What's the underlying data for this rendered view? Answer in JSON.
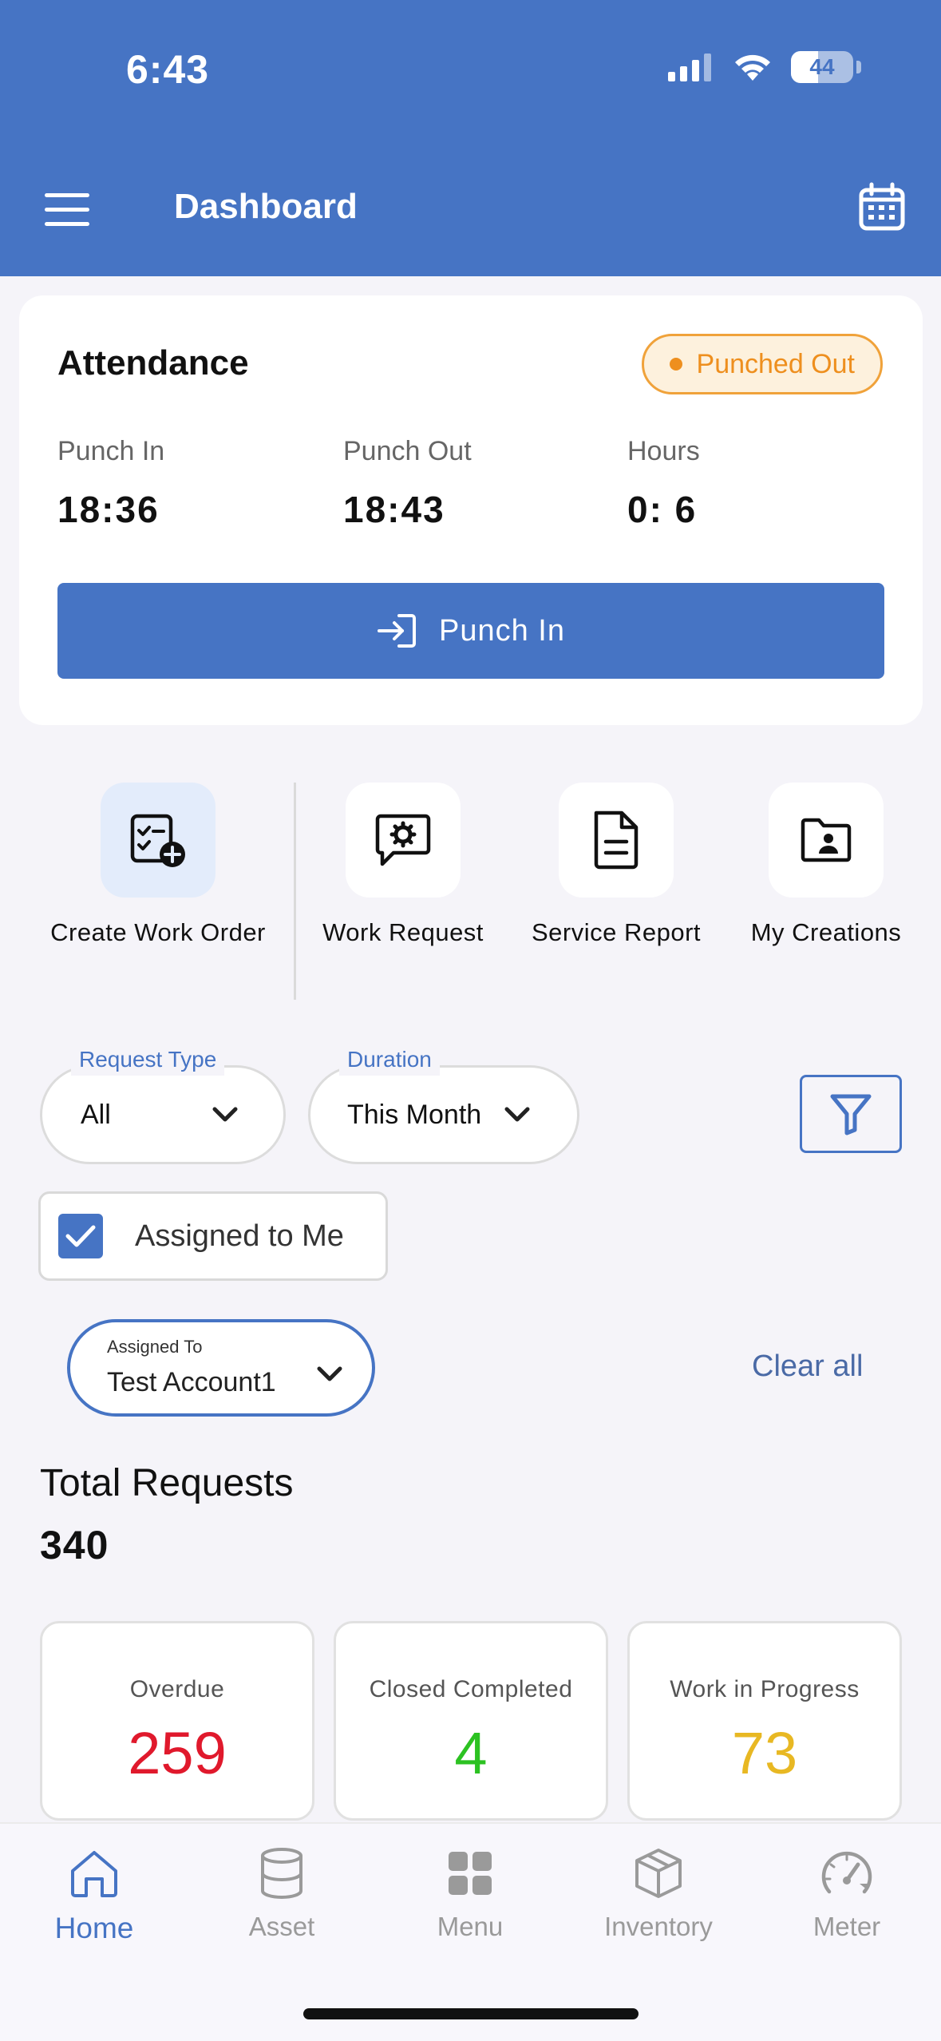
{
  "status_bar": {
    "time": "6:43",
    "battery": "44"
  },
  "header": {
    "title": "Dashboard"
  },
  "attendance": {
    "title": "Attendance",
    "status": "Punched Out",
    "stats": [
      {
        "label": "Punch In",
        "value": "18:36"
      },
      {
        "label": "Punch Out",
        "value": "18:43"
      },
      {
        "label": "Hours",
        "value": "0: 6"
      }
    ],
    "button": "Punch In"
  },
  "actions": [
    {
      "label": "Create Work Order",
      "icon": "create-work-order-icon"
    },
    {
      "label": "Work Request",
      "icon": "work-request-icon"
    },
    {
      "label": "Service Report",
      "icon": "service-report-icon"
    },
    {
      "label": "My Creations",
      "icon": "my-creations-icon"
    }
  ],
  "filters": {
    "request_type": {
      "label": "Request Type",
      "value": "All"
    },
    "duration": {
      "label": "Duration",
      "value": "This Month"
    },
    "assigned_to_me": {
      "label": "Assigned to Me",
      "checked": true
    },
    "assigned_to": {
      "label": "Assigned To",
      "value": "Test Account1"
    },
    "clear_all": "Clear all"
  },
  "totals": {
    "label": "Total Requests",
    "value": "340"
  },
  "summary_cards": [
    {
      "label": "Overdue",
      "value": "259",
      "color": "#e0192c"
    },
    {
      "label": "Closed Completed",
      "value": "4",
      "color": "#2cc222"
    },
    {
      "label": "Work in Progress",
      "value": "73",
      "color": "#e8b823"
    }
  ],
  "tabs": [
    {
      "label": "Home",
      "icon": "home-icon",
      "active": true
    },
    {
      "label": "Asset",
      "icon": "database-icon",
      "active": false
    },
    {
      "label": "Menu",
      "icon": "grid-icon",
      "active": false
    },
    {
      "label": "Inventory",
      "icon": "box-icon",
      "active": false
    },
    {
      "label": "Meter",
      "icon": "gauge-icon",
      "active": false
    }
  ],
  "colors": {
    "primary": "#4674c4",
    "warning": "#ee8f1e",
    "background": "#f5f4f9"
  }
}
